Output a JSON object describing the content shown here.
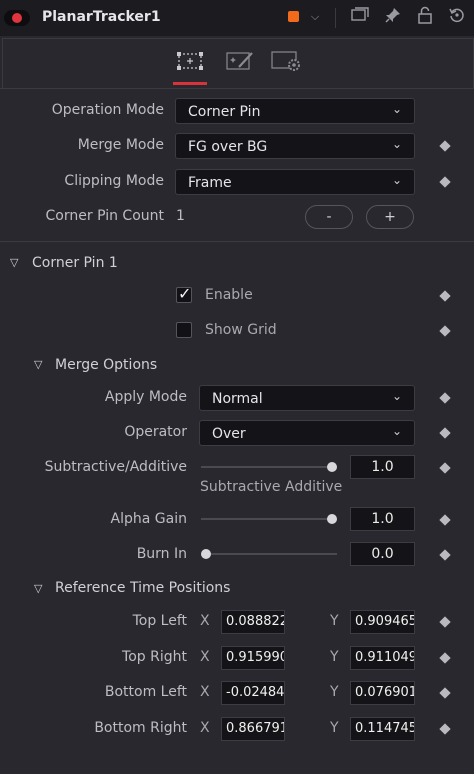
{
  "header": {
    "title": "PlanarTracker1",
    "color_swatch": "#f26a1b",
    "icons": [
      "window-icon",
      "pin-icon",
      "lock-icon",
      "reset-icon"
    ]
  },
  "tabs": [
    {
      "name": "tracker-tab",
      "icon": "corner-pin-icon",
      "active": true
    },
    {
      "name": "paint-tab",
      "icon": "magic-wand-icon",
      "active": false
    },
    {
      "name": "settings-tab",
      "icon": "gear-icon",
      "active": false
    }
  ],
  "controls": {
    "operation_mode": {
      "label": "Operation Mode",
      "value": "Corner Pin"
    },
    "merge_mode": {
      "label": "Merge Mode",
      "value": "FG over BG"
    },
    "clipping_mode": {
      "label": "Clipping Mode",
      "value": "Frame"
    },
    "corner_pin_count": {
      "label": "Corner Pin Count",
      "value": "1",
      "minus": "-",
      "plus": "+"
    }
  },
  "corner_pin": {
    "title": "Corner Pin 1",
    "enable": {
      "label": "Enable",
      "checked": true,
      "check_glyph": "✓"
    },
    "show_grid": {
      "label": "Show Grid",
      "checked": false
    }
  },
  "merge_options": {
    "title": "Merge Options",
    "apply_mode": {
      "label": "Apply Mode",
      "value": "Normal"
    },
    "operator": {
      "label": "Operator",
      "value": "Over"
    },
    "subtractive_additive": {
      "label": "Subtractive/Additive",
      "value": "1.0",
      "left_label": "Subtractive",
      "right_label": "Additive",
      "level": 1.0
    },
    "alpha_gain": {
      "label": "Alpha Gain",
      "value": "1.0",
      "level": 1.0
    },
    "burn_in": {
      "label": "Burn In",
      "value": "0.0",
      "level": 0.0
    }
  },
  "reference_time_positions": {
    "title": "Reference Time Positions",
    "x_label": "X",
    "y_label": "Y",
    "rows": [
      {
        "label": "Top Left",
        "x": "0.088822",
        "y": "0.909465"
      },
      {
        "label": "Top Right",
        "x": "0.915990",
        "y": "0.911049"
      },
      {
        "label": "Bottom Left",
        "x": "-0.02484",
        "y": "0.076901"
      },
      {
        "label": "Bottom Right",
        "x": "0.866791",
        "y": "0.114745"
      }
    ]
  },
  "colors": {
    "accent": "#d8323b",
    "record": "#e0353f"
  }
}
